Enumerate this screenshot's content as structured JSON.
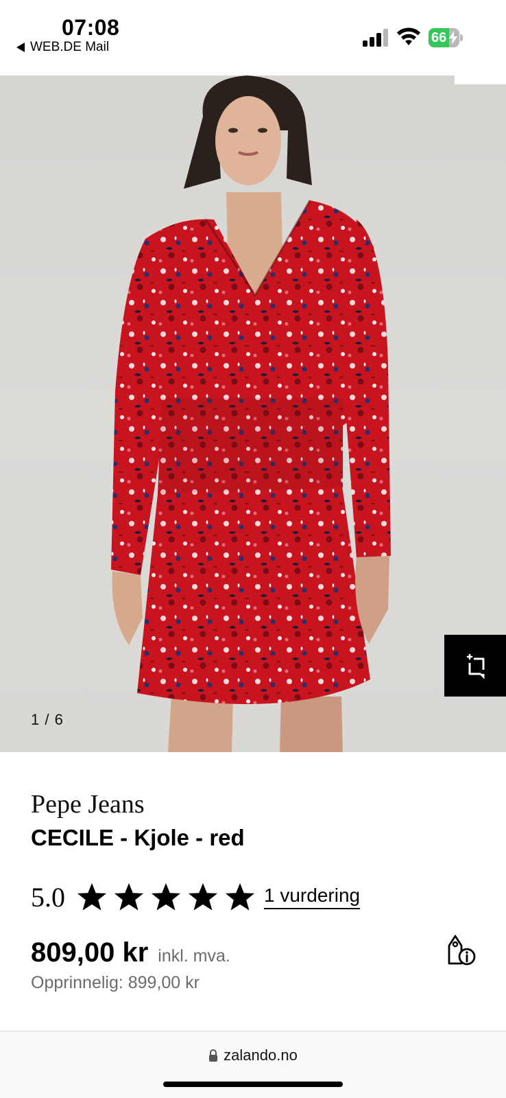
{
  "status_bar": {
    "time": "07:08",
    "back_app": "WEB.DE Mail",
    "battery_level": 66,
    "battery_label": "66",
    "icons": [
      "back-arrow-icon",
      "signal-icon",
      "wifi-icon",
      "battery-charging-icon"
    ]
  },
  "gallery": {
    "counter": "1 / 6",
    "current_index": 1,
    "total": 6,
    "dress_color": "#c8141f",
    "visual_search_icon": "visual-search-icon"
  },
  "product": {
    "brand": "Pepe Jeans",
    "title": "CECILE - Kjole - red",
    "rating": {
      "score_label": "5.0",
      "score": 5.0,
      "stars": 5,
      "reviews_label": "1 vurdering"
    },
    "price": "809,00 kr",
    "vat_label": "inkl. mva.",
    "original_price": "Opprinnelig: 899,00 kr",
    "price_info_icon": "price-tag-info-icon"
  },
  "browser": {
    "url": "zalando.no",
    "lock_icon": "lock-icon"
  },
  "colors": {
    "accent": "#000000",
    "muted_text": "#6b6b6b",
    "battery_green": "#34c759"
  }
}
